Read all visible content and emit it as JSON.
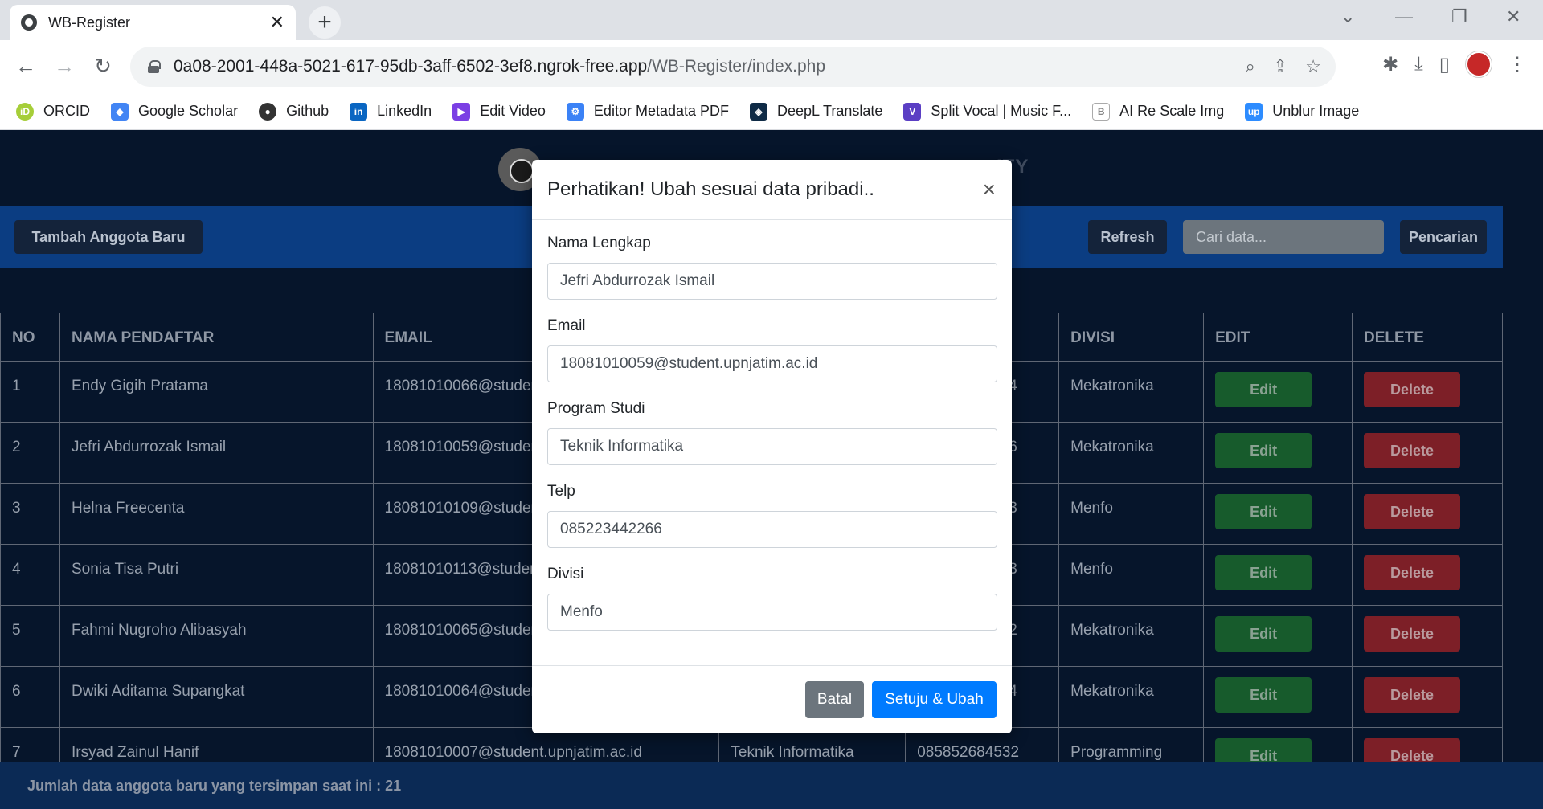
{
  "browser": {
    "tab_title": "WB-Register",
    "tab_close": "✕",
    "new_tab": "+",
    "url_host": "0a08-2001-448a-5021-617-95db-3aff-6502-3ef8.ngrok-free.app",
    "url_path": "/WB-Register/index.php",
    "bookmarks": [
      {
        "label": "ORCID",
        "color": "#a6ce39"
      },
      {
        "label": "Google Scholar",
        "color": "#4285f4"
      },
      {
        "label": "Github",
        "color": "#333333"
      },
      {
        "label": "LinkedIn",
        "color": "#0a66c2"
      },
      {
        "label": "Edit Video",
        "color": "#7b3fe4"
      },
      {
        "label": "Editor Metadata PDF",
        "color": "#3b82f6"
      },
      {
        "label": "DeepL Translate",
        "color": "#0f2b46"
      },
      {
        "label": "Split Vocal | Music F...",
        "color": "#5b3fc4"
      },
      {
        "label": "AI Re Scale Img",
        "color": "#888888"
      },
      {
        "label": "Unblur Image",
        "color": "#2d8cff"
      }
    ]
  },
  "page": {
    "title_fragment": "ITY",
    "add_button": "Tambah Anggota Baru",
    "refresh_button": "Refresh",
    "search_placeholder": "Cari data...",
    "search_button": "Pencarian",
    "footer_text": "Jumlah data anggota baru yang tersimpan saat ini : 21"
  },
  "table": {
    "headers": [
      "NO",
      "NAMA PENDAFTAR",
      "EMAIL",
      "DIVISI",
      "EDIT",
      "DELETE"
    ],
    "edit_label": "Edit",
    "delete_label": "Delete",
    "rows": [
      {
        "no": "1",
        "name": "Endy Gigih Pratama",
        "email": "18081010066@studer",
        "phone_tail": "4",
        "divisi": "Mekatronika"
      },
      {
        "no": "2",
        "name": "Jefri Abdurrozak Ismail",
        "email": "18081010059@studer",
        "phone_tail": "6",
        "divisi": "Mekatronika"
      },
      {
        "no": "3",
        "name": "Helna Freecenta",
        "email": "18081010109@studer",
        "phone_tail": "3",
        "divisi": "Menfo"
      },
      {
        "no": "4",
        "name": "Sonia Tisa Putri",
        "email": "18081010113@studer",
        "phone_tail": "3",
        "divisi": "Menfo"
      },
      {
        "no": "5",
        "name": "Fahmi Nugroho Alibasyah",
        "email": "18081010065@studer",
        "phone_tail": "2",
        "divisi": "Mekatronika"
      },
      {
        "no": "6",
        "name": "Dwiki Aditama Supangkat",
        "email": "18081010064@studer",
        "phone_tail": "4",
        "divisi": "Mekatronika"
      },
      {
        "no": "7",
        "name": "Irsyad Zainul Hanif",
        "email": "18081010007@student.upnjatim.ac.id",
        "prodi": "Teknik Informatika",
        "phone": "085852684532",
        "divisi": "Programming"
      }
    ]
  },
  "modal": {
    "title": "Perhatikan! Ubah sesuai data pribadi..",
    "close": "×",
    "fields": [
      {
        "label": "Nama Lengkap",
        "value": "Jefri Abdurrozak Ismail"
      },
      {
        "label": "Email",
        "value": "18081010059@student.upnjatim.ac.id"
      },
      {
        "label": "Program Studi",
        "value": "Teknik Informatika"
      },
      {
        "label": "Telp",
        "value": "085223442266"
      },
      {
        "label": "Divisi",
        "value": "Menfo"
      }
    ],
    "cancel_button": "Batal",
    "submit_button": "Setuju & Ubah"
  }
}
